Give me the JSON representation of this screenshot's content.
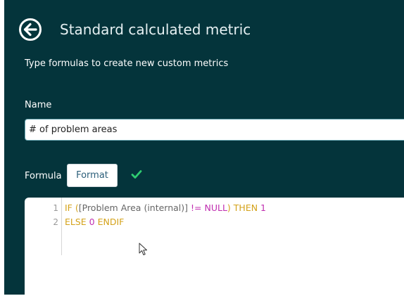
{
  "header": {
    "title": "Standard calculated metric",
    "back_icon": "back-arrow-icon"
  },
  "subtitle": "Type formulas to create new custom metrics",
  "name_field": {
    "label": "Name",
    "value": "# of problem areas"
  },
  "formula": {
    "label": "Formula",
    "format_button": "Format",
    "valid_icon": "check-icon",
    "valid_color": "#2ecc71",
    "lines": [
      {
        "number": "1",
        "tokens": [
          {
            "text": "IF ",
            "kind": "kw"
          },
          {
            "text": "(",
            "kind": "kw"
          },
          {
            "text": "[Problem Area (internal)]",
            "kind": "field"
          },
          {
            "text": " != ",
            "kind": "op"
          },
          {
            "text": "NULL",
            "kind": "op"
          },
          {
            "text": ") ",
            "kind": "kw"
          },
          {
            "text": "THEN ",
            "kind": "kw"
          },
          {
            "text": "1",
            "kind": "num"
          }
        ]
      },
      {
        "number": "2",
        "tokens": [
          {
            "text": "ELSE ",
            "kind": "kw"
          },
          {
            "text": "0",
            "kind": "num"
          },
          {
            "text": " ENDIF",
            "kind": "kw"
          }
        ]
      }
    ]
  },
  "colors": {
    "panel_bg": "#04343b",
    "keyword": "#d4a21a",
    "operator": "#c02fb0"
  }
}
